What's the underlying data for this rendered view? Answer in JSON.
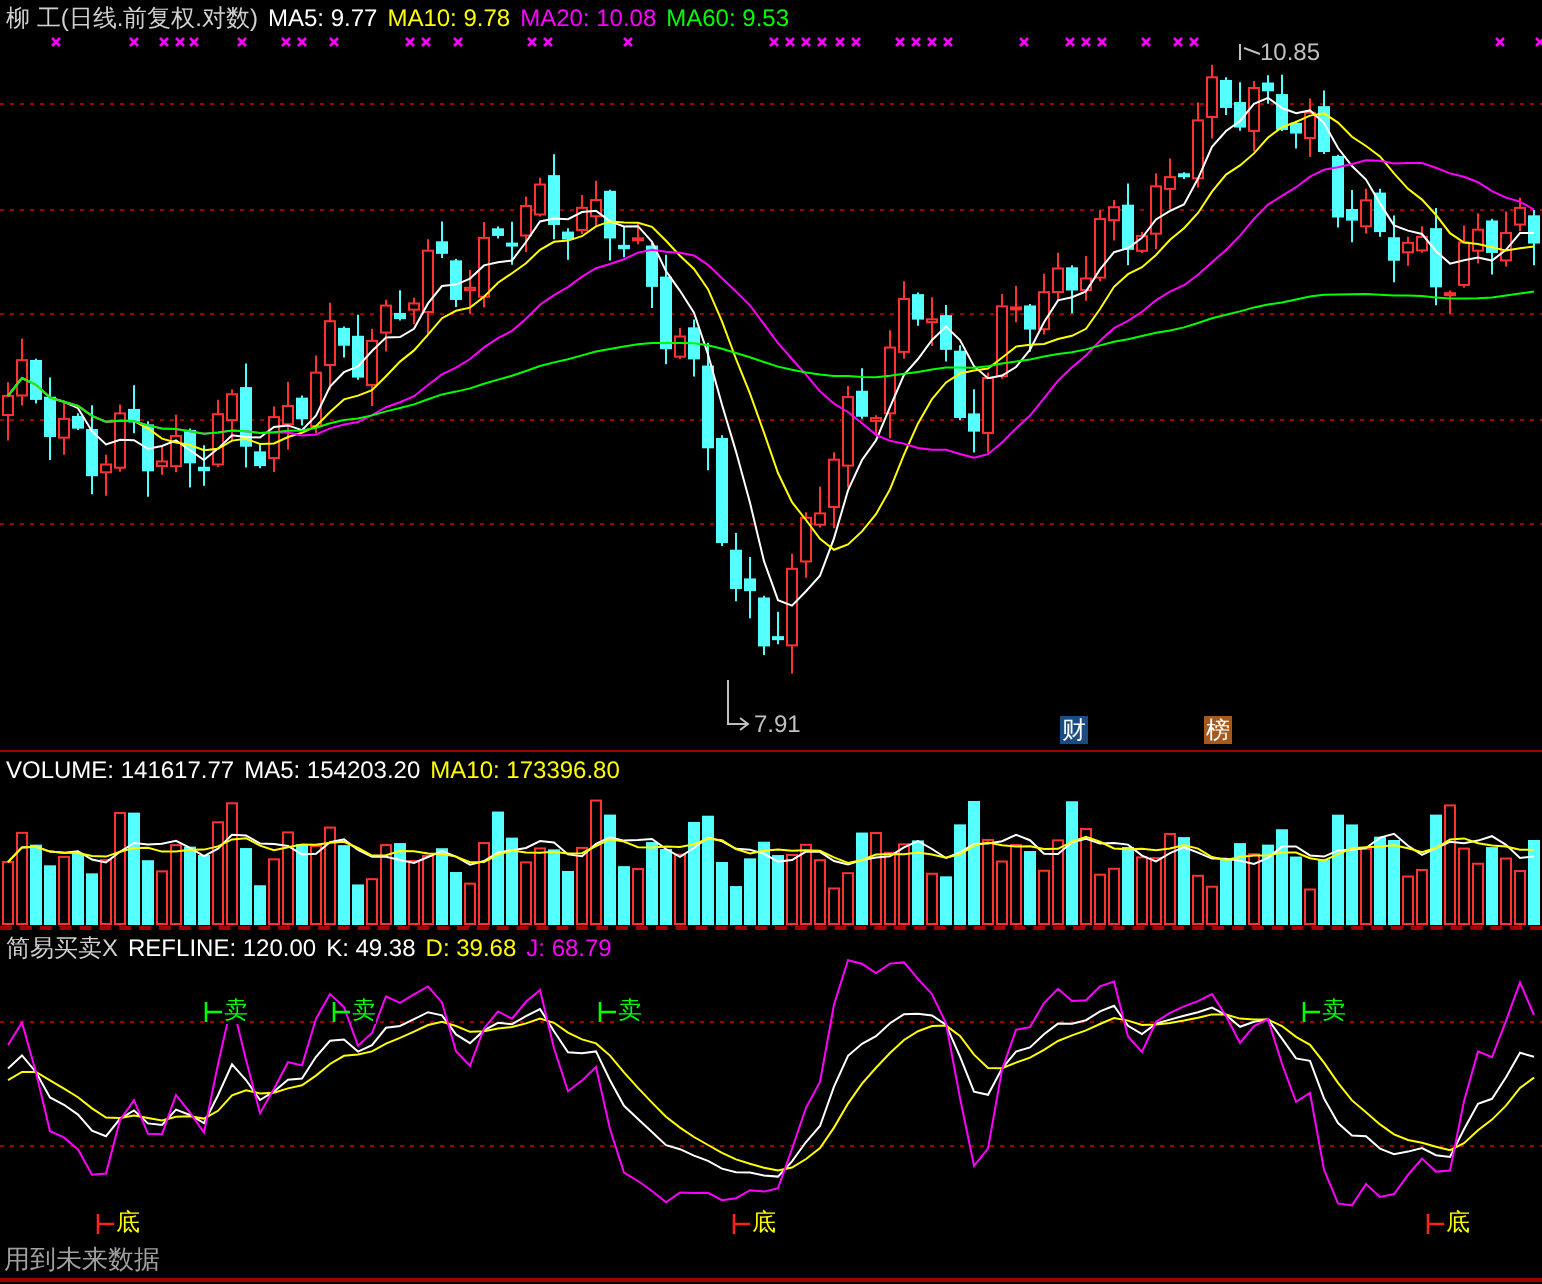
{
  "main": {
    "title": "柳 工(日线.前复权.对数)",
    "indicators": [
      {
        "label": "MA5: 9.77",
        "color": "#ffffff"
      },
      {
        "label": "MA10: 9.78",
        "color": "#ffff00"
      },
      {
        "label": "MA20: 10.08",
        "color": "#ff00ff"
      },
      {
        "label": "MA60: 9.53",
        "color": "#00ff00"
      }
    ],
    "high_label": "10.85",
    "low_label": "7.91",
    "badges": [
      {
        "text": "财",
        "color": "#1c4b82"
      },
      {
        "text": "榜",
        "color": "#a45a1e"
      }
    ]
  },
  "volume": {
    "indicators": [
      {
        "label": "VOLUME: 141617.77",
        "color": "#ffffff"
      },
      {
        "label": "MA5: 154203.20",
        "color": "#ffffff"
      },
      {
        "label": "MA10: 173396.80",
        "color": "#ffff00"
      }
    ]
  },
  "kdj": {
    "title": "简易买卖X",
    "indicators": [
      {
        "label": "REFLINE: 120.00",
        "color": "#ffffff"
      },
      {
        "label": "K: 49.38",
        "color": "#ffffff"
      },
      {
        "label": "D: 39.68",
        "color": "#ffff00"
      },
      {
        "label": "J: 68.79",
        "color": "#ff00ff"
      }
    ],
    "signals": [
      {
        "text": "卖",
        "kind": "sell"
      },
      {
        "text": "卖",
        "kind": "sell"
      },
      {
        "text": "卖",
        "kind": "sell"
      },
      {
        "text": "卖",
        "kind": "sell"
      },
      {
        "text": "底",
        "kind": "bottom"
      },
      {
        "text": "底",
        "kind": "bottom"
      },
      {
        "text": "底",
        "kind": "bottom"
      }
    ],
    "note": "用到未来数据"
  }
}
